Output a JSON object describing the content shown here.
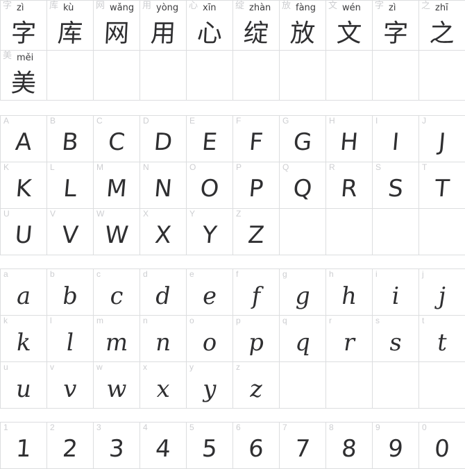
{
  "document": {
    "kind": "font-specimen-sheet",
    "background_color": "#ffffff",
    "grid_line_color": "#dcdddf",
    "label_color": "#cdced1",
    "glyph_color": "#2f2f31",
    "pinyin_color": "#3b3b3d",
    "columns": 10
  },
  "cjk_section": {
    "name": "chinese-character-samples",
    "rows": [
      [
        {
          "label": "字",
          "pinyin": "zì",
          "glyph": "字"
        },
        {
          "label": "库",
          "pinyin": "kù",
          "glyph": "库"
        },
        {
          "label": "网",
          "pinyin": "wǎng",
          "glyph": "网"
        },
        {
          "label": "用",
          "pinyin": "yòng",
          "glyph": "用"
        },
        {
          "label": "心",
          "pinyin": "xīn",
          "glyph": "心"
        },
        {
          "label": "绽",
          "pinyin": "zhàn",
          "glyph": "绽"
        },
        {
          "label": "放",
          "pinyin": "fàng",
          "glyph": "放"
        },
        {
          "label": "文",
          "pinyin": "wén",
          "glyph": "文"
        },
        {
          "label": "字",
          "pinyin": "zì",
          "glyph": "字"
        },
        {
          "label": "之",
          "pinyin": "zhī",
          "glyph": "之"
        }
      ],
      [
        {
          "label": "美",
          "pinyin": "měi",
          "glyph": "美"
        },
        {
          "label": "",
          "pinyin": "",
          "glyph": ""
        },
        {
          "label": "",
          "pinyin": "",
          "glyph": ""
        },
        {
          "label": "",
          "pinyin": "",
          "glyph": ""
        },
        {
          "label": "",
          "pinyin": "",
          "glyph": ""
        },
        {
          "label": "",
          "pinyin": "",
          "glyph": ""
        },
        {
          "label": "",
          "pinyin": "",
          "glyph": ""
        },
        {
          "label": "",
          "pinyin": "",
          "glyph": ""
        },
        {
          "label": "",
          "pinyin": "",
          "glyph": ""
        },
        {
          "label": "",
          "pinyin": "",
          "glyph": ""
        }
      ]
    ]
  },
  "uppercase_section": {
    "name": "uppercase-latin-samples",
    "rows": [
      [
        {
          "label": "A",
          "glyph": "A"
        },
        {
          "label": "B",
          "glyph": "B"
        },
        {
          "label": "C",
          "glyph": "C"
        },
        {
          "label": "D",
          "glyph": "D"
        },
        {
          "label": "E",
          "glyph": "E"
        },
        {
          "label": "F",
          "glyph": "F"
        },
        {
          "label": "G",
          "glyph": "G"
        },
        {
          "label": "H",
          "glyph": "H"
        },
        {
          "label": "I",
          "glyph": "I"
        },
        {
          "label": "J",
          "glyph": "J"
        }
      ],
      [
        {
          "label": "K",
          "glyph": "K"
        },
        {
          "label": "L",
          "glyph": "L"
        },
        {
          "label": "M",
          "glyph": "M"
        },
        {
          "label": "N",
          "glyph": "N"
        },
        {
          "label": "O",
          "glyph": "O"
        },
        {
          "label": "P",
          "glyph": "P"
        },
        {
          "label": "Q",
          "glyph": "Q"
        },
        {
          "label": "R",
          "glyph": "R"
        },
        {
          "label": "S",
          "glyph": "S"
        },
        {
          "label": "T",
          "glyph": "T"
        }
      ],
      [
        {
          "label": "U",
          "glyph": "U"
        },
        {
          "label": "V",
          "glyph": "V"
        },
        {
          "label": "W",
          "glyph": "W"
        },
        {
          "label": "X",
          "glyph": "X"
        },
        {
          "label": "Y",
          "glyph": "Y"
        },
        {
          "label": "Z",
          "glyph": "Z"
        },
        {
          "label": "",
          "glyph": ""
        },
        {
          "label": "",
          "glyph": ""
        },
        {
          "label": "",
          "glyph": ""
        },
        {
          "label": "",
          "glyph": ""
        }
      ]
    ]
  },
  "lowercase_section": {
    "name": "lowercase-latin-samples",
    "rows": [
      [
        {
          "label": "a",
          "glyph": "a"
        },
        {
          "label": "b",
          "glyph": "b"
        },
        {
          "label": "c",
          "glyph": "c"
        },
        {
          "label": "d",
          "glyph": "d"
        },
        {
          "label": "e",
          "glyph": "e"
        },
        {
          "label": "f",
          "glyph": "f"
        },
        {
          "label": "g",
          "glyph": "g"
        },
        {
          "label": "h",
          "glyph": "h"
        },
        {
          "label": "i",
          "glyph": "i"
        },
        {
          "label": "j",
          "glyph": "j"
        }
      ],
      [
        {
          "label": "k",
          "glyph": "k"
        },
        {
          "label": "l",
          "glyph": "l"
        },
        {
          "label": "m",
          "glyph": "m"
        },
        {
          "label": "n",
          "glyph": "n"
        },
        {
          "label": "o",
          "glyph": "o"
        },
        {
          "label": "p",
          "glyph": "p"
        },
        {
          "label": "q",
          "glyph": "q"
        },
        {
          "label": "r",
          "glyph": "r"
        },
        {
          "label": "s",
          "glyph": "s"
        },
        {
          "label": "t",
          "glyph": "t"
        }
      ],
      [
        {
          "label": "u",
          "glyph": "u"
        },
        {
          "label": "v",
          "glyph": "v"
        },
        {
          "label": "w",
          "glyph": "w"
        },
        {
          "label": "x",
          "glyph": "x"
        },
        {
          "label": "y",
          "glyph": "y"
        },
        {
          "label": "z",
          "glyph": "z"
        },
        {
          "label": "",
          "glyph": ""
        },
        {
          "label": "",
          "glyph": ""
        },
        {
          "label": "",
          "glyph": ""
        },
        {
          "label": "",
          "glyph": ""
        }
      ]
    ]
  },
  "digit_section": {
    "name": "numeral-samples",
    "rows": [
      [
        {
          "label": "1",
          "glyph": "1"
        },
        {
          "label": "2",
          "glyph": "2"
        },
        {
          "label": "3",
          "glyph": "3"
        },
        {
          "label": "4",
          "glyph": "4"
        },
        {
          "label": "5",
          "glyph": "5"
        },
        {
          "label": "6",
          "glyph": "6"
        },
        {
          "label": "7",
          "glyph": "7"
        },
        {
          "label": "8",
          "glyph": "8"
        },
        {
          "label": "9",
          "glyph": "9"
        },
        {
          "label": "0",
          "glyph": "0"
        }
      ]
    ]
  }
}
